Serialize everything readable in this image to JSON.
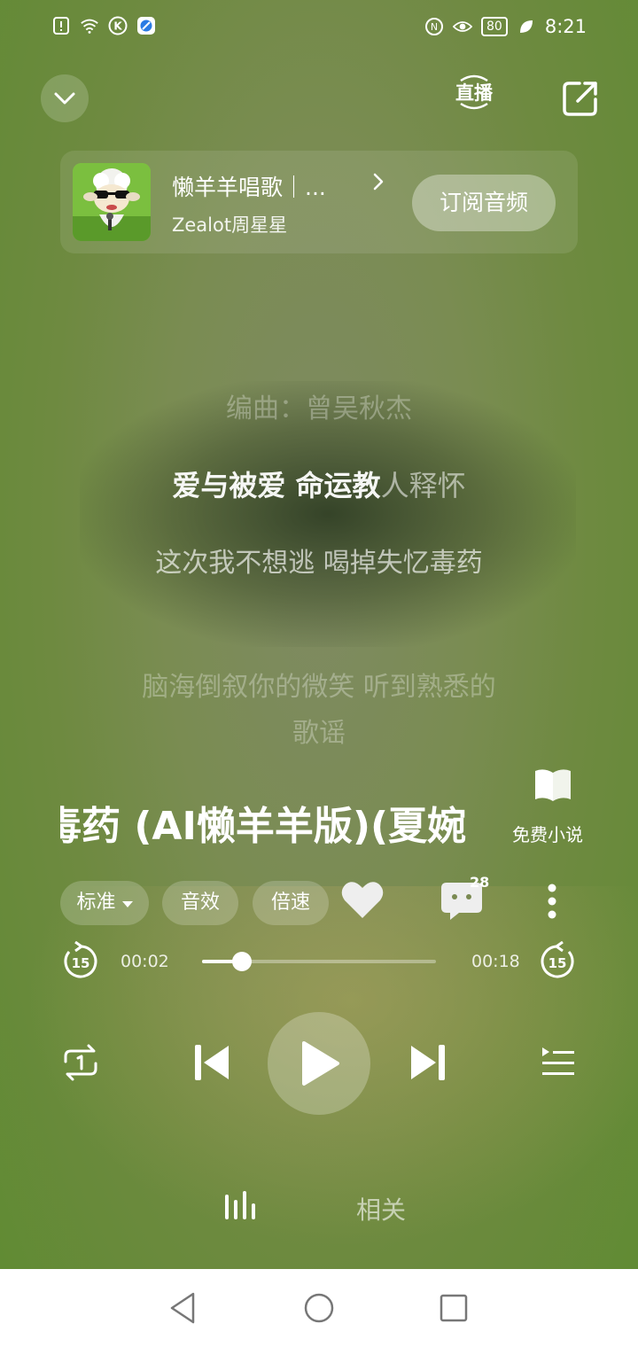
{
  "status_bar": {
    "time": "8:21",
    "battery": "80",
    "icons": [
      "alert-icon",
      "wifi-icon",
      "k-app-icon",
      "browser-icon",
      "nfc-icon",
      "eye-icon",
      "leaf-icon"
    ]
  },
  "top_bar": {
    "collapse_icon": "chevron-down-icon",
    "live_label": "直播",
    "share_icon": "share-icon"
  },
  "album": {
    "title": "懒羊羊唱歌｜...",
    "author": "Zealot周星星",
    "subscribe_label": "订阅音频"
  },
  "lyrics": {
    "credit": "编曲：曾吴秋杰",
    "current_sung": "爱与被爱 命运教",
    "current_unsung": "人释怀",
    "next": "这次我不想逃 喝掉失忆毒药",
    "next2": "脑海倒叙你的微笑 听到熟悉的歌谣"
  },
  "promo": {
    "novel_label": "免费小说"
  },
  "song": {
    "title": "毒药 (AI懒羊羊版)(夏婉安)"
  },
  "chips": {
    "quality": "标准",
    "effect": "音效",
    "speed": "倍速"
  },
  "social": {
    "comment_count": "28"
  },
  "playback": {
    "skip_back": "15",
    "skip_forward": "15",
    "current_time": "00:02",
    "total_time": "00:18",
    "progress": 0.17
  },
  "tabs": {
    "related": "相关"
  },
  "colors": {
    "background": "#6e8a40",
    "accent": "#ffffff"
  }
}
